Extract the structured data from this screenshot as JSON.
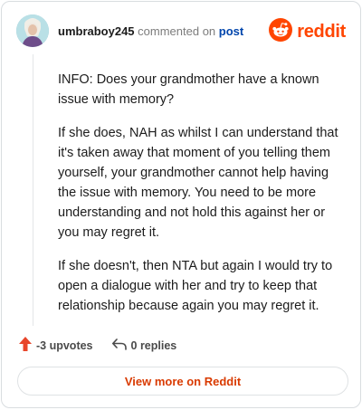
{
  "header": {
    "username": "umbraboy245",
    "action_text": "commented on",
    "post_link": "post",
    "brand_word": "reddit"
  },
  "comment": {
    "paragraphs": [
      "INFO: Does your grandmother have a known issue with memory?",
      "If she does, NAH as whilst I can understand that it's taken away that moment of you telling them yourself, your grandmother cannot help having the issue with memory. You need to be more understanding and not hold this against her or you may regret it.",
      "If she doesn't, then NTA but again I would try to open a dialogue with her and try to keep that relationship because again you may regret it."
    ]
  },
  "actions": {
    "upvotes_label": "-3 upvotes",
    "replies_label": "0 replies"
  },
  "footer": {
    "view_more_label": "View more on Reddit"
  },
  "colors": {
    "brand": "#ff4500",
    "link": "#0045ac",
    "cta": "#d93a00"
  },
  "icons": [
    "avatar",
    "reddit-logo-icon",
    "upvote-arrow-icon",
    "reply-icon"
  ]
}
